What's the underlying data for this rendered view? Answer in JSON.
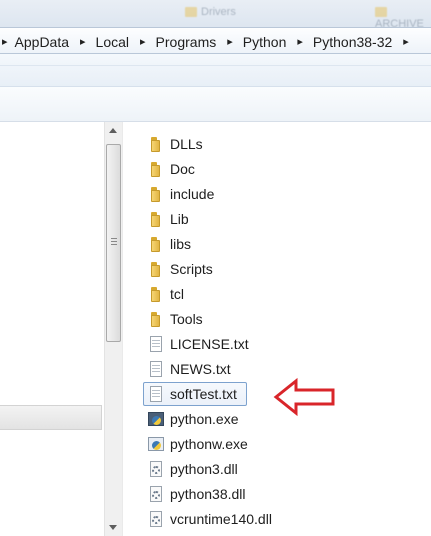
{
  "background_window": {
    "items": [
      "Drivers",
      "ARCHIVE"
    ]
  },
  "breadcrumb": {
    "segments": [
      "AppData",
      "Local",
      "Programs",
      "Python",
      "Python38-32"
    ]
  },
  "files": [
    {
      "name": "DLLs",
      "type": "folder-icon"
    },
    {
      "name": "Doc",
      "type": "folder-icon"
    },
    {
      "name": "include",
      "type": "folder-icon"
    },
    {
      "name": "Lib",
      "type": "folder-icon"
    },
    {
      "name": "libs",
      "type": "folder-icon"
    },
    {
      "name": "Scripts",
      "type": "folder-icon"
    },
    {
      "name": "tcl",
      "type": "folder-icon"
    },
    {
      "name": "Tools",
      "type": "folder-icon"
    },
    {
      "name": "LICENSE.txt",
      "type": "text-file-icon"
    },
    {
      "name": "NEWS.txt",
      "type": "text-file-icon"
    },
    {
      "name": "softTest.txt",
      "type": "text-file-icon",
      "selected": true
    },
    {
      "name": "python.exe",
      "type": "python-exe-icon"
    },
    {
      "name": "pythonw.exe",
      "type": "pythonw-exe-icon"
    },
    {
      "name": "python3.dll",
      "type": "dll-file-icon"
    },
    {
      "name": "python38.dll",
      "type": "dll-file-icon"
    },
    {
      "name": "vcruntime140.dll",
      "type": "dll-file-icon"
    }
  ],
  "annotation": {
    "color": "#d9252a",
    "icon": "red-arrow-left-icon"
  },
  "colors": {
    "selection_border": "#7da2ce",
    "folder": "#f0c654"
  }
}
